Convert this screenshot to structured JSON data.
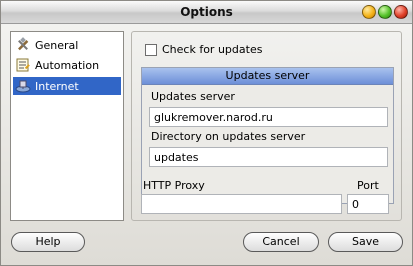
{
  "window": {
    "title": "Options"
  },
  "nav": {
    "items": [
      {
        "label": "General",
        "icon": "tools-icon"
      },
      {
        "label": "Automation",
        "icon": "script-icon"
      },
      {
        "label": "Internet",
        "icon": "network-icon",
        "selected": true
      }
    ]
  },
  "internet": {
    "check_updates_label": "Check for updates",
    "updates_server_header": "Updates server",
    "server_label": "Updates server",
    "server_value": "glukremover.narod.ru",
    "directory_label": "Directory on updates server",
    "directory_value": "updates",
    "proxy_label": "HTTP Proxy",
    "proxy_value": "",
    "port_label": "Port",
    "port_value": "0"
  },
  "buttons": {
    "help": "Help",
    "cancel": "Cancel",
    "save": "Save"
  },
  "colors": {
    "selection": "#3166c7",
    "group_header": "#7f9fe0"
  }
}
